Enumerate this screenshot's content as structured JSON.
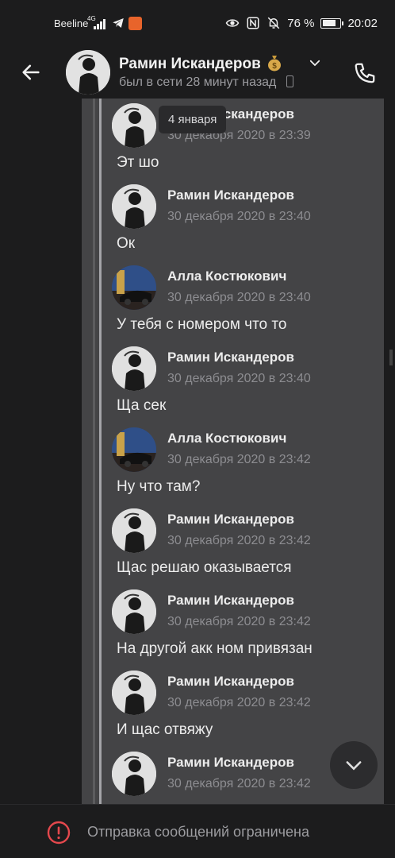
{
  "status_bar": {
    "carrier": "Beeline",
    "network": "4G",
    "battery": "76 %",
    "battery_level": 0.76,
    "time": "20:02"
  },
  "header": {
    "contact_name": "Рамин Искандеров",
    "status": "был в сети 28 минут назад"
  },
  "date_chip": "4 января",
  "messages": [
    {
      "sender": "Рамин Искандеров",
      "time": "30 декабря 2020 в 23:39",
      "text": "Эт шо",
      "avatar": "ramin"
    },
    {
      "sender": "Рамин Искандеров",
      "time": "30 декабря 2020 в 23:40",
      "text": "Ок",
      "avatar": "ramin"
    },
    {
      "sender": "Алла Костюкович",
      "time": "30 декабря 2020 в 23:40",
      "text": "У тебя с номером что то",
      "avatar": "alla"
    },
    {
      "sender": "Рамин Искандеров",
      "time": "30 декабря 2020 в 23:40",
      "text": "Ща сек",
      "avatar": "ramin"
    },
    {
      "sender": "Алла Костюкович",
      "time": "30 декабря 2020 в 23:42",
      "text": "Ну что там?",
      "avatar": "alla"
    },
    {
      "sender": "Рамин Искандеров",
      "time": "30 декабря 2020 в 23:42",
      "text": "Щас решаю оказывается",
      "avatar": "ramin"
    },
    {
      "sender": "Рамин Искандеров",
      "time": "30 декабря 2020 в 23:42",
      "text": "На другой акк ном привязан",
      "avatar": "ramin"
    },
    {
      "sender": "Рамин Искандеров",
      "time": "30 декабря 2020 в 23:42",
      "text": "И щас отвяжу",
      "avatar": "ramin"
    },
    {
      "sender": "Рамин Искандеров",
      "time": "30 декабря 2020 в 23:42",
      "text": "",
      "avatar": "ramin"
    }
  ],
  "bottom_bar": {
    "text": "Отправка сообщений ограничена"
  },
  "colors": {
    "background": "#1c1c1d",
    "panel": "#444446",
    "accent_line": "#a4a4a8",
    "warning": "#e5484d"
  }
}
